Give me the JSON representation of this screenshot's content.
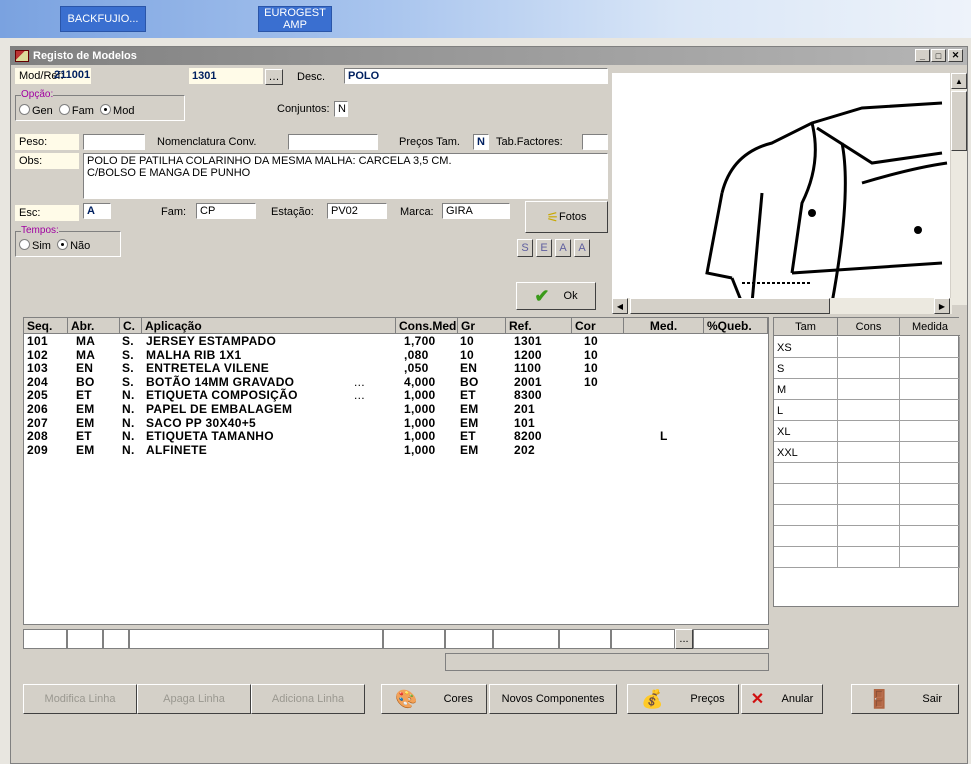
{
  "taskbar": {
    "item1": "BACKFUJIO...",
    "item2_line1": "EUROGEST",
    "item2_line2": "AMP"
  },
  "window": {
    "title": "Registo de Modelos"
  },
  "form": {
    "modref_label": "Mod/Ref:",
    "modref_value": "211001",
    "modref_value2": "1301",
    "desc_label": "Desc.",
    "desc_value": "POLO",
    "opcao_label": "Opção:",
    "opcao_options": [
      "Gen",
      "Fam",
      "Mod"
    ],
    "opcao_selected": "Mod",
    "conjuntos_label": "Conjuntos:",
    "conjuntos_value": "N",
    "peso_label": "Peso:",
    "peso_value": "",
    "nomenclatura_label": "Nomenclatura Conv.",
    "nomenclatura_value": "",
    "precos_tam_label": "Preços Tam.",
    "precos_tam_value": "N",
    "tab_factores_label": "Tab.Factores:",
    "tab_factores_value": "",
    "obs_label": "Obs:",
    "obs_line1": "POLO DE PATILHA COLARINHO DA MESMA MALHA: CARCELA 3,5 CM.",
    "obs_line2": "C/BOLSO E MANGA DE PUNHO",
    "esc_label": "Esc:",
    "esc_value": "A",
    "fam_label": "Fam:",
    "fam_value": "CP",
    "estacao_label": "Estação:",
    "estacao_value": "PV02",
    "marca_label": "Marca:",
    "marca_value": "GIRA",
    "tempos_label": "Tempos:",
    "tempos_options": [
      "Sim",
      "Não"
    ],
    "tempos_selected": "Não",
    "fotos_label": "Fotos",
    "seal_buttons": [
      "S",
      "E",
      "A",
      "A"
    ],
    "ok_label": "Ok"
  },
  "grid": {
    "headers": [
      "Seq.",
      "Abr.",
      "C.",
      "Aplicação",
      "Cons.Med",
      "Gr",
      "Ref.",
      "Cor",
      "Med.",
      "%Queb."
    ],
    "rows": [
      {
        "seq": "101",
        "abr": "MA",
        "c": "S.",
        "aplicacao": "JERSEY ESTAMPADO",
        "dots": "",
        "cons": "1,700",
        "gr": "10",
        "ref": "1301",
        "cor": "10",
        "med": ""
      },
      {
        "seq": "102",
        "abr": "MA",
        "c": "S.",
        "aplicacao": "MALHA RIB 1X1",
        "dots": "",
        "cons": ",080",
        "gr": "10",
        "ref": "1200",
        "cor": "10",
        "med": ""
      },
      {
        "seq": "103",
        "abr": "EN",
        "c": "S.",
        "aplicacao": "ENTRETELA VILENE",
        "dots": "",
        "cons": ",050",
        "gr": "EN",
        "ref": "1100",
        "cor": "10",
        "med": ""
      },
      {
        "seq": "204",
        "abr": "BO",
        "c": "S.",
        "aplicacao": "BOTÃO 14MM GRAVADO",
        "dots": "...",
        "cons": "4,000",
        "gr": "BO",
        "ref": "2001",
        "cor": "10",
        "med": ""
      },
      {
        "seq": "205",
        "abr": "ET",
        "c": "N.",
        "aplicacao": "ETIQUETA COMPOSIÇÃO",
        "dots": "...",
        "cons": "1,000",
        "gr": "ET",
        "ref": "8300",
        "cor": "",
        "med": ""
      },
      {
        "seq": "206",
        "abr": "EM",
        "c": "N.",
        "aplicacao": "PAPEL DE EMBALAGEM",
        "dots": "",
        "cons": "1,000",
        "gr": "EM",
        "ref": "201",
        "cor": "",
        "med": ""
      },
      {
        "seq": "207",
        "abr": "EM",
        "c": "N.",
        "aplicacao": "SACO PP 30X40+5",
        "dots": "",
        "cons": "1,000",
        "gr": "EM",
        "ref": "101",
        "cor": "",
        "med": ""
      },
      {
        "seq": "208",
        "abr": "ET",
        "c": "N.",
        "aplicacao": "ETIQUETA TAMANHO",
        "dots": "",
        "cons": "1,000",
        "gr": "ET",
        "ref": "8200",
        "cor": "",
        "med": "L"
      },
      {
        "seq": "209",
        "abr": "EM",
        "c": "N.",
        "aplicacao": "ALFINETE",
        "dots": "",
        "cons": "1,000",
        "gr": "EM",
        "ref": "202",
        "cor": "",
        "med": ""
      }
    ]
  },
  "sizes": {
    "headers": [
      "Tam",
      "Cons",
      "Medida"
    ],
    "rows": [
      "XS",
      "S",
      "M",
      "L",
      "XL",
      "XXL",
      "",
      "",
      "",
      "",
      ""
    ]
  },
  "edit_row": {
    "ellipsis": "..."
  },
  "buttons": {
    "modifica": "Modifica Linha",
    "apaga": "Apaga Linha",
    "adiciona": "Adiciona Linha",
    "cores": "Cores",
    "novos": "Novos Componentes",
    "precos": "Preços",
    "anular": "Anular",
    "sair": "Sair"
  }
}
